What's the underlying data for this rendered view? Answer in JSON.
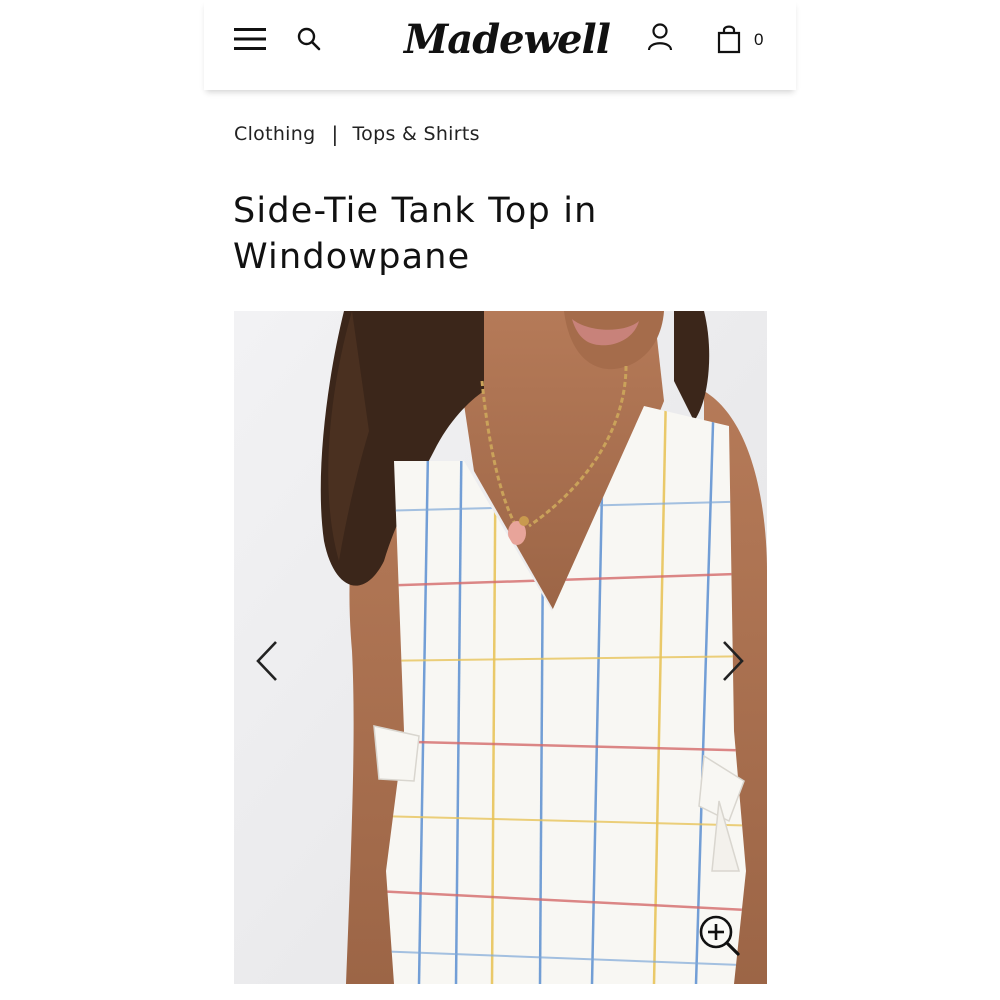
{
  "header": {
    "brand": "Madewell",
    "bag_count": "0",
    "icons": [
      "hamburger-menu-icon",
      "search-icon",
      "account-icon",
      "shopping-bag-icon"
    ]
  },
  "breadcrumb": {
    "items": [
      {
        "label": "Clothing"
      },
      {
        "label": "Tops & Shirts"
      }
    ],
    "separator": "|"
  },
  "product": {
    "title": "Side-Tie Tank Top in Windowpane"
  },
  "gallery": {
    "icons": [
      "chevron-left-icon",
      "chevron-right-icon",
      "zoom-in-icon"
    ]
  },
  "colors": {
    "text": "#1a1a1a",
    "background": "#ffffff",
    "image_background": "#ececec",
    "plaid_blue": "#5b8fd0",
    "plaid_red": "#d46a6a",
    "plaid_yellow": "#e8c45a"
  }
}
